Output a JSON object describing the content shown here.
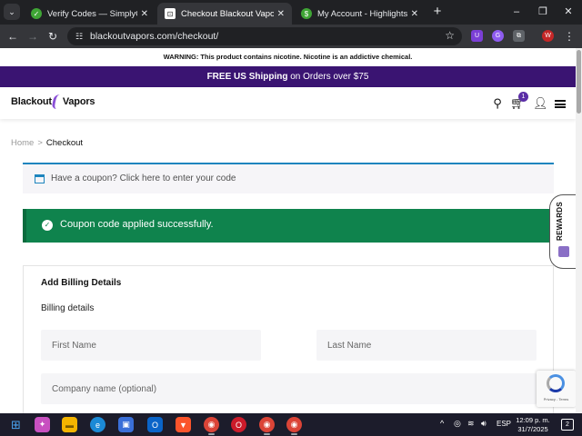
{
  "browser": {
    "tabs": [
      {
        "title": "Verify Codes — SimplyCodes",
        "favicon_color": "#3fa535",
        "favicon_glyph": "✓",
        "active": false
      },
      {
        "title": "Checkout Blackout Vapors Online",
        "favicon_color": "#ffffff",
        "favicon_glyph": "⊡",
        "active": true
      },
      {
        "title": "My Account - Highlights",
        "favicon_color": "#3fa535",
        "favicon_glyph": "$",
        "active": false
      }
    ],
    "new_tab_glyph": "+",
    "window_controls": {
      "minimize": "–",
      "maximize": "❐",
      "close": "✕"
    },
    "nav": {
      "back": "←",
      "forward": "→",
      "reload": "↻"
    },
    "url": "blackoutvapors.com/checkout/",
    "extensions": [
      {
        "name": "shield-extension-icon",
        "color": "#7b3fd6",
        "glyph": "U"
      },
      {
        "name": "grammar-extension-icon",
        "color": "#8e5cf0",
        "glyph": "G"
      },
      {
        "name": "puzzle-extension-icon",
        "color": "#5f6368",
        "glyph": "⧉"
      },
      {
        "name": "profile-avatar-icon",
        "color": "#c52727",
        "glyph": "W"
      }
    ]
  },
  "site": {
    "warning": "WARNING: This product contains nicotine. Nicotine is an addictive chemical.",
    "promo_bold": "FREE US Shipping",
    "promo_rest": " on Orders over $75",
    "logo_left": "Blackout",
    "logo_right": "Vapors",
    "cart_count": "1",
    "breadcrumb": {
      "home": "Home",
      "separator": ">",
      "current": "Checkout"
    },
    "coupon_prompt": "Have a coupon? Click here to enter your code",
    "success_message": "Coupon code applied successfully.",
    "billing": {
      "title": "Add Billing Details",
      "subtitle": "Billing details",
      "first_name_placeholder": "First Name",
      "last_name_placeholder": "Last Name",
      "company_placeholder": "Company name (optional)"
    },
    "rewards_label": "REWARDS",
    "recaptcha_text": "Privacy - Terms",
    "colors": {
      "promo_bg": "#3a1472",
      "success_bg": "#0f834d",
      "coupon_accent": "#1e85be"
    }
  },
  "taskbar": {
    "apps": [
      {
        "name": "windows-start-icon",
        "glyph": "⊞",
        "color": "transparent"
      },
      {
        "name": "copilot-icon",
        "glyph": "✦",
        "color": "#c850c0"
      },
      {
        "name": "file-explorer-icon",
        "glyph": "▬",
        "color": "#f4b400"
      },
      {
        "name": "edge-icon",
        "glyph": "e",
        "color": "#1b8ad6"
      },
      {
        "name": "store-icon",
        "glyph": "▣",
        "color": "#3a6fd8"
      },
      {
        "name": "outlook-icon",
        "glyph": "O",
        "color": "#0a64c8"
      },
      {
        "name": "brave-icon",
        "glyph": "▼",
        "color": "#fb542b"
      },
      {
        "name": "chrome-icon",
        "glyph": "◉",
        "color": "#db4437"
      },
      {
        "name": "opera-icon",
        "glyph": "O",
        "color": "#cc1b2a"
      },
      {
        "name": "chrome-profile-2-icon",
        "glyph": "◉",
        "color": "#db4437"
      },
      {
        "name": "chrome-profile-3-icon",
        "glyph": "◉",
        "color": "#db4437"
      }
    ],
    "tray_chevron": "^",
    "language": "ESP",
    "time": "12:09 p. m.",
    "date": "31/7/2025",
    "notification_count": "2"
  }
}
